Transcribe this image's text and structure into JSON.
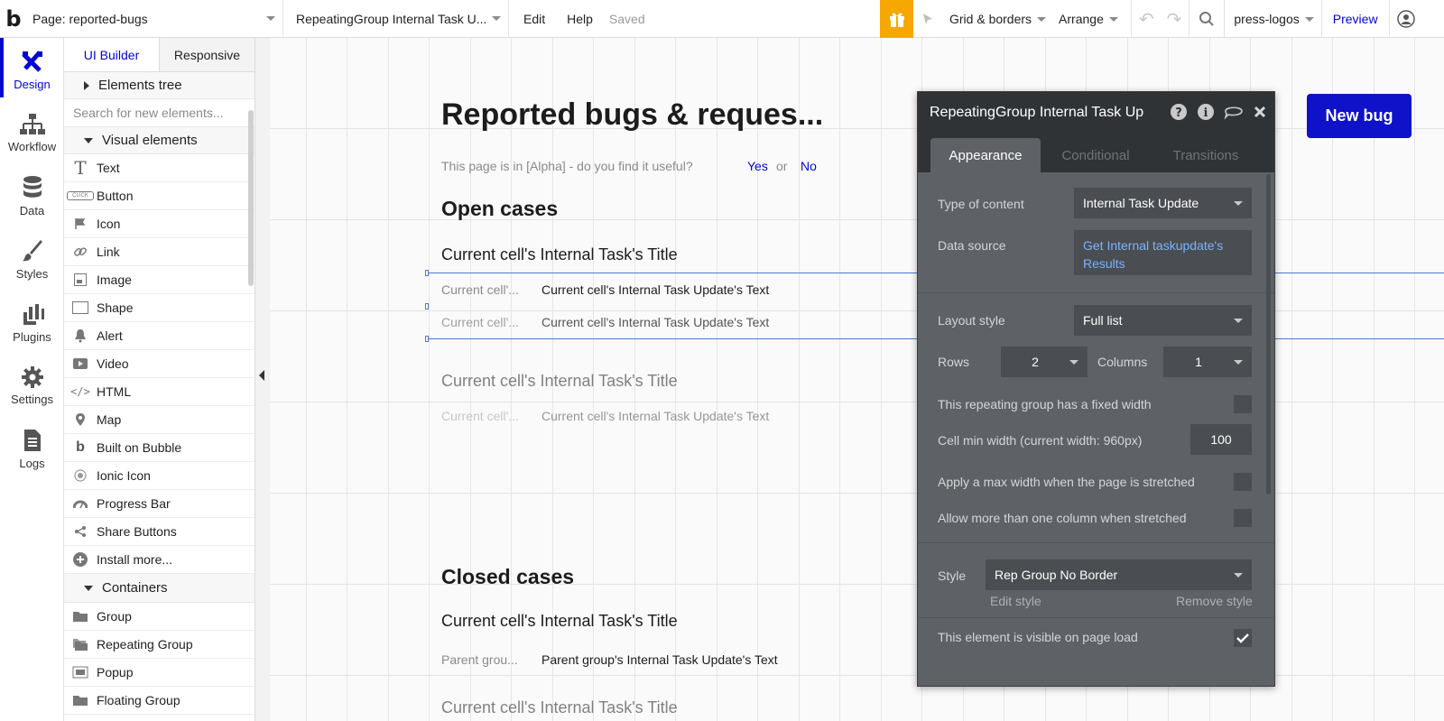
{
  "topbar": {
    "logo": "b",
    "page_select": "Page: reported-bugs",
    "element_select": "RepeatingGroup Internal Task U...",
    "menu": [
      "Edit",
      "Help"
    ],
    "saved": "Saved",
    "grid_borders": "Grid & borders",
    "arrange": "Arrange",
    "app_select": "press-logos",
    "preview": "Preview"
  },
  "rail": [
    {
      "label": "Design",
      "icon": "design-icon"
    },
    {
      "label": "Workflow",
      "icon": "workflow-icon"
    },
    {
      "label": "Data",
      "icon": "database-icon"
    },
    {
      "label": "Styles",
      "icon": "brush-icon"
    },
    {
      "label": "Plugins",
      "icon": "plugin-icon"
    },
    {
      "label": "Settings",
      "icon": "gear-icon"
    },
    {
      "label": "Logs",
      "icon": "document-icon"
    }
  ],
  "panel": {
    "tabs": [
      "UI Builder",
      "Responsive"
    ],
    "elements_tree": "Elements tree",
    "search_placeholder": "Search for new elements...",
    "visual_elements": "Visual elements",
    "items": [
      {
        "label": "Text",
        "icon": "text-icon"
      },
      {
        "label": "Button",
        "icon": "button-icon"
      },
      {
        "label": "Icon",
        "icon": "flag-icon"
      },
      {
        "label": "Link",
        "icon": "link-icon"
      },
      {
        "label": "Image",
        "icon": "image-icon"
      },
      {
        "label": "Shape",
        "icon": "shape-icon"
      },
      {
        "label": "Alert",
        "icon": "bell-icon"
      },
      {
        "label": "Video",
        "icon": "video-icon"
      },
      {
        "label": "HTML",
        "icon": "code-icon"
      },
      {
        "label": "Map",
        "icon": "map-pin-icon"
      },
      {
        "label": "Built on Bubble",
        "icon": "bubble-logo-icon"
      },
      {
        "label": "Ionic Icon",
        "icon": "ionic-icon"
      },
      {
        "label": "Progress Bar",
        "icon": "gauge-icon"
      },
      {
        "label": "Share Buttons",
        "icon": "share-icon"
      },
      {
        "label": "Install more...",
        "icon": "plus-circle-icon"
      }
    ],
    "containers": "Containers",
    "container_items": [
      {
        "label": "Group",
        "icon": "folder-icon"
      },
      {
        "label": "Repeating Group",
        "icon": "repeating-group-icon"
      },
      {
        "label": "Popup",
        "icon": "popup-icon"
      },
      {
        "label": "Floating Group",
        "icon": "floating-group-icon"
      }
    ]
  },
  "canvas": {
    "page_title": "Reported bugs & reques...",
    "alpha_text": "This page is in [Alpha] - do you find it useful?",
    "yes": "Yes",
    "or": "or",
    "no": "No",
    "open_cases": "Open cases",
    "cell_title": "Current cell's Internal Task's Title",
    "cell_label_short": "Current cell'...",
    "cell_text": "Current cell's Internal Task Update's Text",
    "closed_cases": "Closed cases",
    "parent_label_short": "Parent grou...",
    "parent_text": "Parent group's Internal Task Update's Text",
    "new_bug": "New bug"
  },
  "property_editor": {
    "title": "RepeatingGroup Internal Task Up",
    "tabs": [
      "Appearance",
      "Conditional",
      "Transitions"
    ],
    "type_of_content_label": "Type of content",
    "type_of_content": "Internal Task Update",
    "data_source_label": "Data source",
    "data_source": "Get Internal taskupdate's Results",
    "layout_style_label": "Layout style",
    "layout_style": "Full list",
    "rows_label": "Rows",
    "rows": "2",
    "columns_label": "Columns",
    "columns": "1",
    "fixed_width_label": "This repeating group has a fixed width",
    "fixed_width": false,
    "cell_min_width_label": "Cell min width (current width: 960px)",
    "cell_min_width": "100",
    "max_width_label": "Apply a max width when the page is stretched",
    "max_width": false,
    "more_columns_label": "Allow more than one column when stretched",
    "more_columns": false,
    "style_label": "Style",
    "style": "Rep Group No Border",
    "edit_style": "Edit style",
    "remove_style": "Remove style",
    "visible_label": "This element is visible on page load",
    "visible": true
  },
  "colors": {
    "accent": "#0205d3",
    "new_bug_bg": "#0f12c9",
    "gift": "#f6a800",
    "editor_bg": "#5e6165",
    "editor_header": "#303336",
    "link": "#7ab3ff"
  }
}
